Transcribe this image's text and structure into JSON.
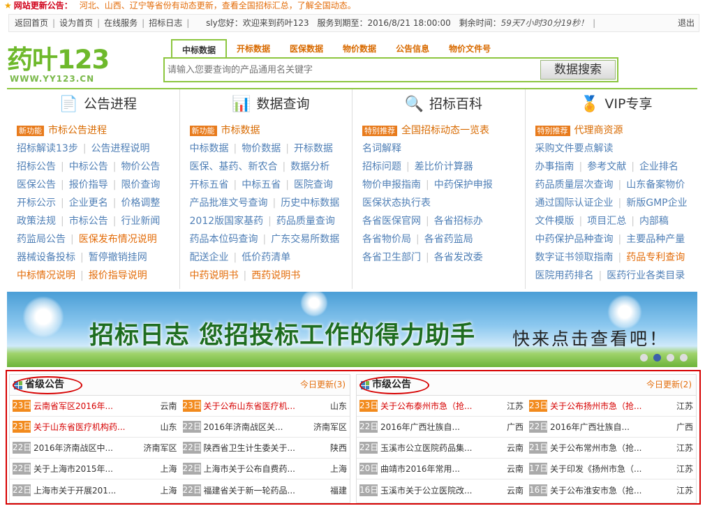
{
  "announcement": {
    "label": "网站更新公告：",
    "message": "河北、山西、辽宁等省份有动态更新，查看全国招标汇总，了解全国动态。"
  },
  "topbar": {
    "links": [
      "返回首页",
      "设为首页",
      "在线服务",
      "招标日志"
    ],
    "greeting": "sly您好：欢迎来到药叶123",
    "service_label": "服务到期至：",
    "service_date": "2016/8/21 18:00:00",
    "remaining_label": "剩余时间：",
    "remaining": "59天7小时30分19秒！",
    "logout": "退出"
  },
  "logo": {
    "main": "药叶123",
    "sub": "WWW.YY123.CN"
  },
  "search": {
    "tabs": [
      "中标数据",
      "开标数据",
      "医保数据",
      "物价数据",
      "公告信息",
      "物价文件号"
    ],
    "placeholder": "请输入您要查询的产品通用名关键字",
    "button": "数据搜索"
  },
  "nav": {
    "col1": {
      "title": "公告进程",
      "badge": "新功能",
      "feature": "市标公告进程",
      "rows": [
        [
          "招标解读13步",
          "公告进程说明"
        ],
        [
          "招标公告",
          "中标公告",
          "物价公告"
        ],
        [
          "医保公告",
          "报价指导",
          "限价查询"
        ],
        [
          "开标公示",
          "企业更名",
          "价格调整"
        ],
        [
          "政策法规",
          "市标公告",
          "行业新闻"
        ],
        [
          "药监局公告",
          "医保发布情况说明"
        ],
        [
          "器械设备投标",
          "暂停撤销挂网"
        ],
        [
          "中标情况说明",
          "报价指导说明"
        ]
      ]
    },
    "col2": {
      "title": "数据查询",
      "badge": "新功能",
      "feature": "市标数据",
      "rows": [
        [
          "中标数据",
          "物价数据",
          "开标数据"
        ],
        [
          "医保、基药、新农合",
          "数据分析"
        ],
        [
          "开标五省",
          "中标五省",
          "医院查询"
        ],
        [
          "产品批准文号查询",
          "历史中标数据"
        ],
        [
          "2012版国家基药",
          "药品质量查询"
        ],
        [
          "药品本位码查询",
          "广东交易所数据"
        ],
        [
          "配送企业",
          "低价药清单"
        ],
        [
          "中药说明书",
          "西药说明书"
        ]
      ]
    },
    "col3": {
      "title": "招标百科",
      "badge": "特别推荐",
      "feature": "全国招标动态一览表",
      "rows": [
        [
          "名词解释"
        ],
        [
          "招标问题",
          "差比价计算器"
        ],
        [
          "物价申报指南",
          "中药保护申报"
        ],
        [
          "医保状态执行表"
        ],
        [
          "各省医保官网",
          "各省招标办"
        ],
        [
          "各省物价局",
          "各省药监局"
        ],
        [
          "各省卫生部门",
          "各省发改委"
        ]
      ]
    },
    "col4": {
      "title": "VIP专享",
      "badge": "特别推荐",
      "feature": "代理商资源",
      "rows": [
        [
          "采购文件要点解读"
        ],
        [
          "办事指南",
          "参考文献",
          "企业排名"
        ],
        [
          "药品质量层次查询",
          "山东备案物价"
        ],
        [
          "通过国际认证企业",
          "新版GMP企业"
        ],
        [
          "文件模版",
          "项目汇总",
          "内部稿"
        ],
        [
          "中药保护品种查询",
          "主要品种产量"
        ],
        [
          "数字证书领取指南",
          "药品专利查询"
        ],
        [
          "医院用药排名",
          "医药行业各类目录"
        ]
      ]
    }
  },
  "banner": {
    "title": "招标日志  您招投标工作的得力助手",
    "cta": "快来点击查看吧！"
  },
  "province": {
    "title": "省级公告",
    "update": "今日更新(3)",
    "rows": [
      [
        {
          "d": "23日",
          "t": "云南省军区2016年...",
          "r": "云南"
        },
        {
          "d": "23日",
          "t": "关于公布山东省医疗机...",
          "r": "山东"
        }
      ],
      [
        {
          "d": "23日",
          "t": "关于山东省医疗机构药...",
          "r": "山东"
        },
        {
          "d": "22日",
          "t": "2016年济南战区关...",
          "r": "济南军区"
        }
      ],
      [
        {
          "d": "22日",
          "t": "2016年济南战区中...",
          "r": "济南军区"
        },
        {
          "d": "22日",
          "t": "陕西省卫生计生委关于...",
          "r": "陕西"
        }
      ],
      [
        {
          "d": "22日",
          "t": "关于上海市2015年...",
          "r": "上海"
        },
        {
          "d": "22日",
          "t": "上海市关于公布自费药...",
          "r": "上海"
        }
      ],
      [
        {
          "d": "22日",
          "t": "上海市关于开展201...",
          "r": "上海"
        },
        {
          "d": "22日",
          "t": "福建省关于新一轮药品...",
          "r": "福建"
        }
      ]
    ]
  },
  "city": {
    "title": "市级公告",
    "update": "今日更新(2)",
    "rows": [
      [
        {
          "d": "23日",
          "t": "关于公布泰州市急（抢...",
          "r": "江苏"
        },
        {
          "d": "23日",
          "t": "关于公布扬州市急（抢...",
          "r": "江苏"
        }
      ],
      [
        {
          "d": "22日",
          "t": "2016年广西壮族自...",
          "r": "广西"
        },
        {
          "d": "22日",
          "t": "2016年广西壮族自...",
          "r": "广西"
        }
      ],
      [
        {
          "d": "22日",
          "t": "玉溪市公立医院药品集...",
          "r": "云南"
        },
        {
          "d": "21日",
          "t": "关于公布常州市急（抢...",
          "r": "江苏"
        }
      ],
      [
        {
          "d": "20日",
          "t": "曲靖市2016年常用...",
          "r": "云南"
        },
        {
          "d": "17日",
          "t": "关于印发《扬州市急（...",
          "r": "江苏"
        }
      ],
      [
        {
          "d": "16日",
          "t": "玉溪市关于公立医院改...",
          "r": "云南"
        },
        {
          "d": "16日",
          "t": "关于公布淮安市急（抢...",
          "r": "江苏"
        }
      ]
    ]
  }
}
